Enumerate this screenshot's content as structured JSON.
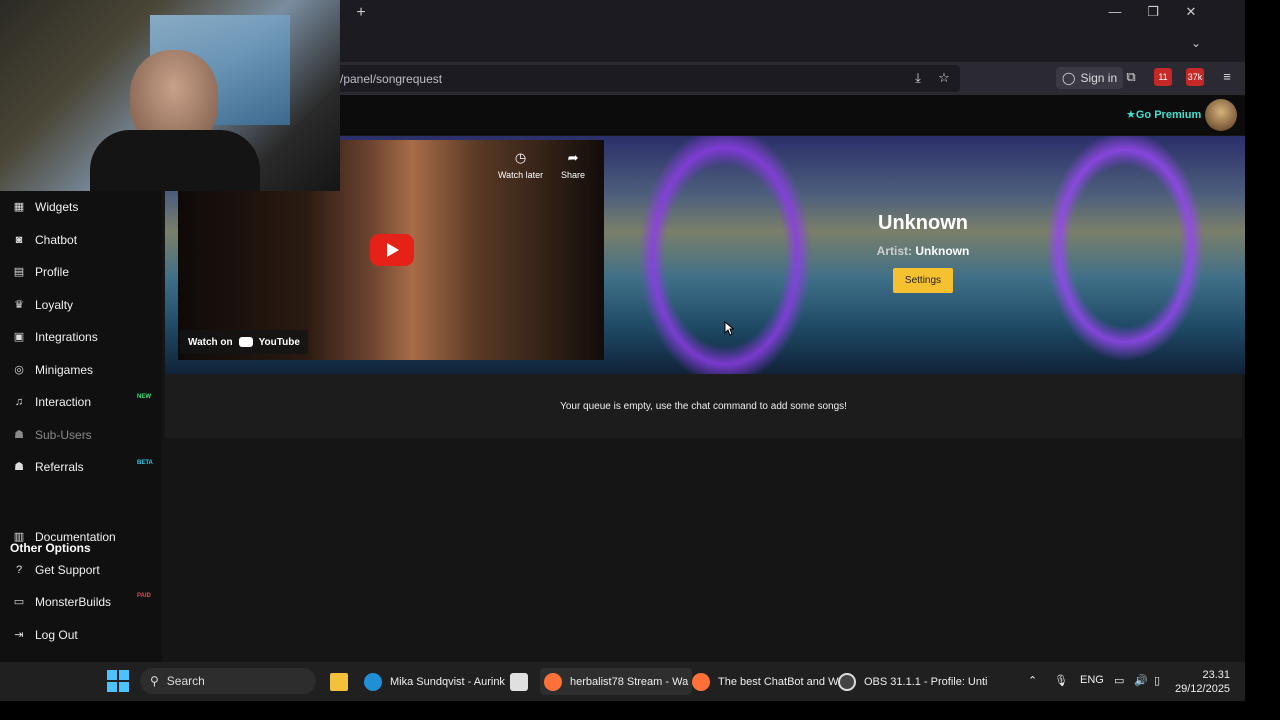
{
  "browser": {
    "url_text": "/panel/songrequest",
    "sign_in_label": "Sign in",
    "ext_badge_1": "11",
    "ext_badge_2": "37k",
    "new_tab_icon": "plus-icon"
  },
  "topbar": {
    "premium_label": "Go Premium"
  },
  "sidebar": {
    "items": [
      {
        "label": "Widgets",
        "icon": "widgets-icon"
      },
      {
        "label": "Chatbot",
        "icon": "robot-icon"
      },
      {
        "label": "Profile",
        "icon": "id-card-icon"
      },
      {
        "label": "Loyalty",
        "icon": "trophy-icon"
      },
      {
        "label": "Integrations",
        "icon": "plug-icon"
      },
      {
        "label": "Minigames",
        "icon": "gamepad-icon"
      },
      {
        "label": "Interaction",
        "icon": "music-icon",
        "tag": "NEW",
        "tag_color": "#3ee07a"
      },
      {
        "label": "Sub-Users",
        "icon": "users-icon"
      },
      {
        "label": "Referrals",
        "icon": "user-group-icon",
        "tag": "BETA",
        "tag_color": "#35c8e0"
      }
    ],
    "other_options_heading": "Other Options",
    "other_items": [
      {
        "label": "Documentation",
        "icon": "book-icon"
      },
      {
        "label": "Get Support",
        "icon": "question-icon"
      },
      {
        "label": "MonsterBuilds",
        "icon": "laptop-icon",
        "tag": "PAID",
        "tag_color": "#e04848"
      },
      {
        "label": "Log Out",
        "icon": "logout-icon"
      }
    ]
  },
  "player": {
    "watch_later": "Watch later",
    "share": "Share",
    "watch_on": "Watch on",
    "youtube": "YouTube"
  },
  "now_playing": {
    "title": "Unknown",
    "artist_label": "Artist:",
    "artist": "Unknown",
    "settings_label": "Settings"
  },
  "queue": {
    "empty_message": "Your queue is empty, use the chat command to add some songs!"
  },
  "taskbar": {
    "search_label": "Search",
    "apps": [
      {
        "label": "Mika Sundqvist - Aurink",
        "color": "#1f8fd6"
      },
      {
        "label": "herbalist78 Stream - Wa",
        "color": "#ff7139"
      },
      {
        "label": "The best ChatBot and W",
        "color": "#ff7139"
      },
      {
        "label": "OBS 31.1.1 - Profile: Unti",
        "color": "#444"
      }
    ],
    "lang": "ENG",
    "time": "23.31",
    "date": "29/12/2025"
  },
  "colors": {
    "accent_premium": "#3fe0d0",
    "settings_button": "#f6c131",
    "youtube_red": "#e62117"
  }
}
